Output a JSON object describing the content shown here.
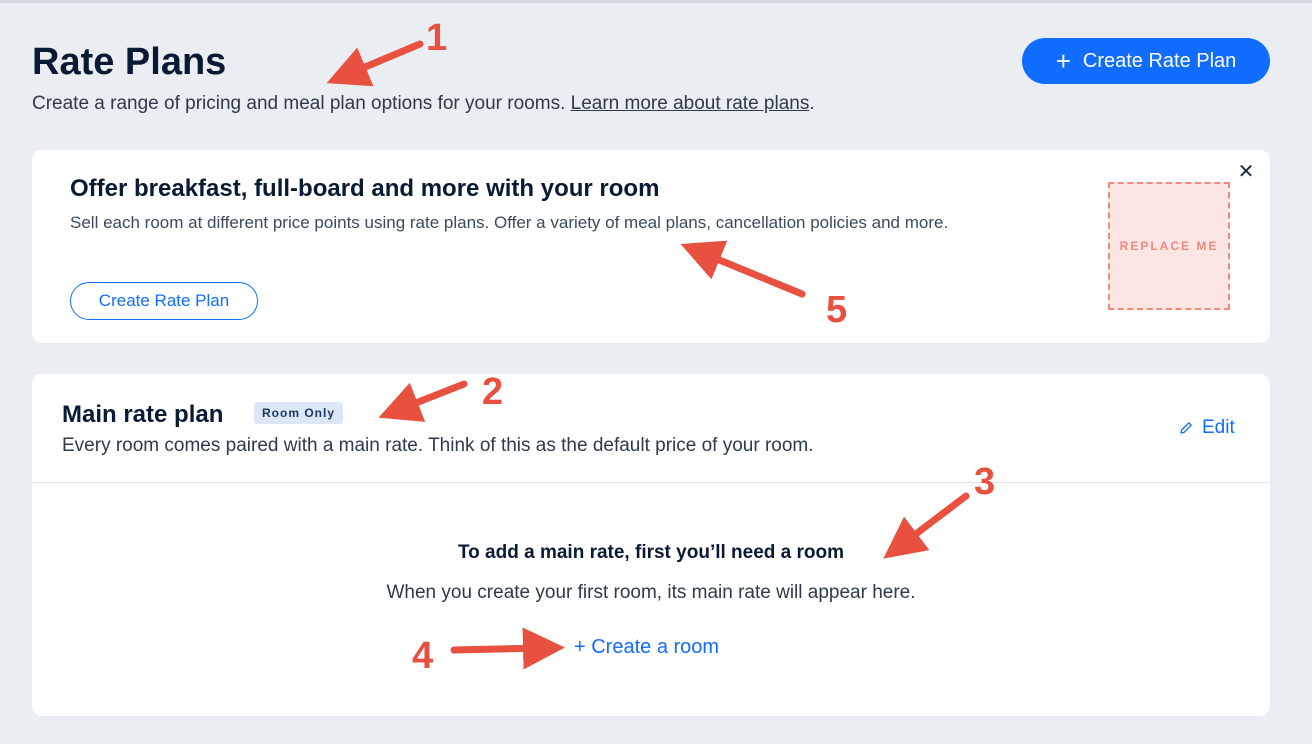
{
  "header": {
    "title": "Rate Plans",
    "subtitle": "Create a range of pricing and meal plan options for your rooms. ",
    "learn_more_link": "Learn more about rate plans",
    "subtitle_end": ".",
    "create_button_icon": "plus-icon",
    "create_button_label": "Create Rate Plan"
  },
  "promo": {
    "title": "Offer breakfast, full-board and more with your room",
    "text": "Sell each room at different price points using rate plans. Offer a variety of meal plans, cancellation policies and more.",
    "button_label": "Create Rate Plan",
    "close_icon": "close-icon",
    "close_glyph": "✕",
    "placeholder_label": "REPLACE ME"
  },
  "main_rate": {
    "title": "Main rate plan",
    "badge": "Room Only",
    "description": "Every room comes paired with a main rate. Think of this as the default price of your room.",
    "edit_icon": "pencil-icon",
    "edit_label": "Edit",
    "empty_title": "To add a main rate, first you’ll need a room",
    "empty_text": "When you create your first room, its main rate will appear here.",
    "create_room_label": "+ Create a room"
  },
  "annotations": {
    "n1": "1",
    "n2": "2",
    "n3": "3",
    "n4": "4",
    "n5": "5",
    "color": "#e8503f"
  },
  "colors": {
    "accent": "#116dff",
    "background": "#eaeef3",
    "placeholder_border": "#f08a80"
  }
}
